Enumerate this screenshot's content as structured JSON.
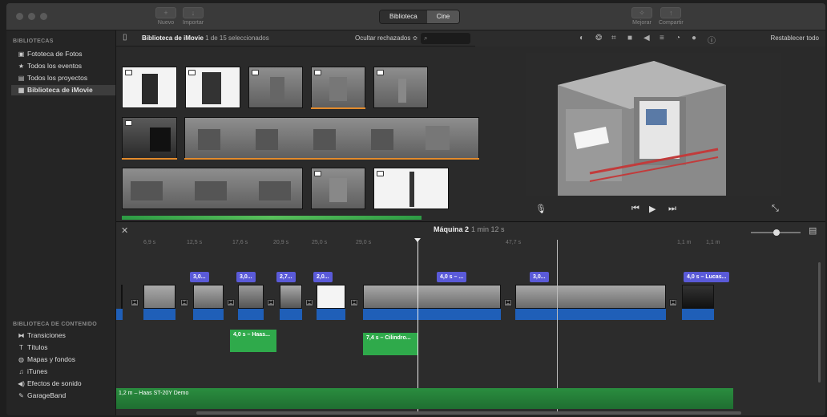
{
  "toolbar": {
    "new_label": "Nuevo",
    "import_label": "Importar",
    "library_tab": "Biblioteca",
    "cinema_tab": "Cine",
    "enhance_label": "Mejorar",
    "share_label": "Compartir"
  },
  "sidebar": {
    "libraries_heading": "BIBLIOTECAS",
    "libraries": [
      {
        "label": "Fototeca de Fotos",
        "icon": "photos-icon"
      },
      {
        "label": "Todos los eventos",
        "icon": "star-icon"
      },
      {
        "label": "Todos los proyectos",
        "icon": "projects-icon"
      },
      {
        "label": "Biblioteca de iMovie",
        "icon": "grid-icon"
      }
    ],
    "content_heading": "BIBLIOTECA DE CONTENIDO",
    "content": [
      {
        "label": "Transiciones",
        "icon": "transitions-icon"
      },
      {
        "label": "Títulos",
        "icon": "titles-icon"
      },
      {
        "label": "Mapas y fondos",
        "icon": "globe-icon"
      },
      {
        "label": "iTunes",
        "icon": "music-icon"
      },
      {
        "label": "Efectos de sonido",
        "icon": "speaker-icon"
      },
      {
        "label": "GarageBand",
        "icon": "guitar-icon"
      }
    ]
  },
  "browser": {
    "library_name": "Biblioteca de iMovie",
    "selection_count": "1 de 15 seleccionados",
    "filter": "Ocultar rechazados ≎"
  },
  "viewer": {
    "reset_label": "Restablecer todo"
  },
  "timeline": {
    "project_name": "Máquina 2",
    "duration": "1 min 12 s",
    "ticks": [
      "6,9 s",
      "12,5 s",
      "17,6 s",
      "20,9 s",
      "25,0 s",
      "29,0 s",
      "47,7 s",
      "1,1 m",
      "1,1 m"
    ],
    "clip_labels": [
      "3,0...",
      "3,0...",
      "2,7...",
      "2,0...",
      "4,0 s – ...",
      "3,0...",
      "4,0 s – Lucas..."
    ],
    "green_labels": [
      "4,0 s – Haas...",
      "7,4 s – Cilindro..."
    ],
    "bg_audio_label": "1,2 m – Haas ST-20Y Demo"
  },
  "colors": {
    "title_clip": "#5a5ad8",
    "audio_green": "#2faa4b",
    "clip_blue": "#1f5fb8",
    "selection_orange": "#e38b2c"
  }
}
